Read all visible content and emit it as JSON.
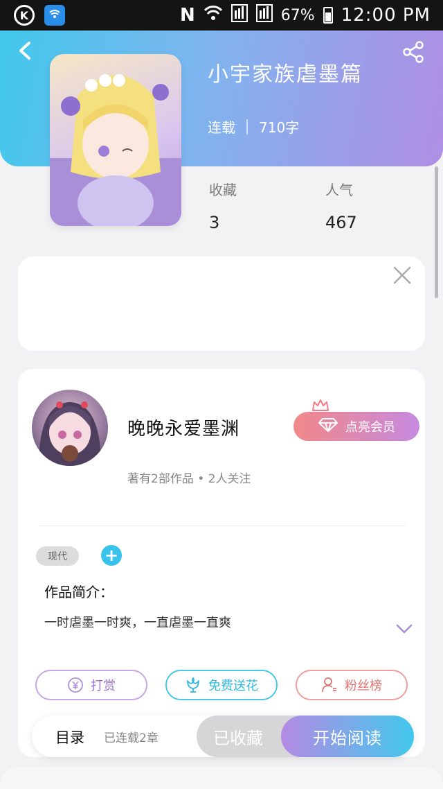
{
  "status_bar": {
    "k_icon": "K",
    "battery": "67%",
    "time": "12:00 PM"
  },
  "book": {
    "title": "小宇家族虐墨篇",
    "status": "连载",
    "word_count": "710字",
    "favorites_label": "收藏",
    "favorites_value": "3",
    "popularity_label": "人气",
    "popularity_value": "467"
  },
  "author": {
    "name": "晚晚永爱墨渊",
    "stats": "著有2部作品 • 2人关注",
    "vip_label": "点亮会员"
  },
  "details": {
    "tag": "现代",
    "add_tag": "+",
    "intro_label": "作品简介：",
    "intro_text": "一时虐墨一时爽，一直虐墨一直爽"
  },
  "actions": {
    "reward": "打赏",
    "flower": "免费送花",
    "fans": "粉丝榜"
  },
  "bottom_bar": {
    "toc_label": "目录",
    "toc_status": "已连载2章",
    "collected_label": "已收藏",
    "read_label": "开始阅读"
  },
  "colors": {
    "header_gradient_start": "#41c8ec",
    "header_gradient_end": "#b08ee3",
    "accent_blue": "#39c3ea",
    "accent_purple": "#b48ae4",
    "vip_gradient_start": "#f28888"
  },
  "icons": [
    "back-icon",
    "share-icon",
    "close-icon",
    "crown-icon",
    "diamond-icon",
    "yen-icon",
    "flower-icon",
    "user-icon",
    "chevron-down-icon"
  ]
}
